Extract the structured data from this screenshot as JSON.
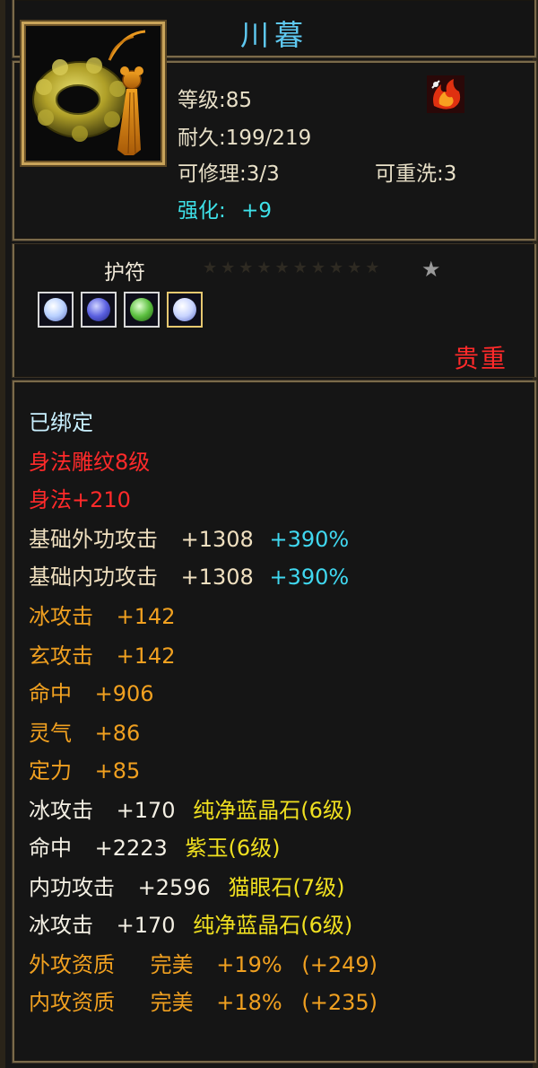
{
  "item": {
    "name": "川暮",
    "level_text": "等级:85",
    "durability_text": "耐久:199/219",
    "repairable_text": "可修理:3/3",
    "rewash_text": "可重洗:3",
    "enhance_label": "强化:",
    "enhance_value": "+9",
    "icon": "jade-ring-pendant-icon",
    "badge_icon": "flame-emblem-icon"
  },
  "amulet": {
    "label": "护符",
    "faded_text": "★★★★★★★★★★",
    "star_icon": "star-icon",
    "gems": [
      {
        "name": "white-gem-icon",
        "color": "#b8d0ff"
      },
      {
        "name": "blue-gem-icon",
        "color": "#5a60e0"
      },
      {
        "name": "green-gem-icon",
        "color": "#5cc040"
      },
      {
        "name": "white-gem-icon",
        "color": "#c8d4ff"
      }
    ],
    "rarity": "贵重"
  },
  "stats": {
    "bound": "已绑定",
    "engraving": "身法雕纹8级",
    "agility": "身法+210",
    "base_ext_attack": {
      "label": "基础外功攻击",
      "value": "+1308",
      "percent": "+390%"
    },
    "base_int_attack": {
      "label": "基础内功攻击",
      "value": "+1308",
      "percent": "+390%"
    },
    "ice_attack": {
      "label": "冰攻击",
      "value": "+142"
    },
    "xuan_attack": {
      "label": "玄攻击",
      "value": "+142"
    },
    "hit": {
      "label": "命中",
      "value": "+906"
    },
    "spirit": {
      "label": "灵气",
      "value": "+86"
    },
    "focus": {
      "label": "定力",
      "value": "+85"
    },
    "gem_line_1": {
      "label": "冰攻击",
      "value": "+170",
      "gem": "纯净蓝晶石(6级)"
    },
    "gem_line_2": {
      "label": "命中",
      "value": "+2223",
      "gem": "紫玉(6级)"
    },
    "gem_line_3": {
      "label": "内功攻击",
      "value": "+2596",
      "gem": "猫眼石(7级)"
    },
    "gem_line_4": {
      "label": "冰攻击",
      "value": "+170",
      "gem": "纯净蓝晶石(6级)"
    },
    "ext_aptitude": {
      "label": "外攻资质",
      "grade": "完美",
      "percent": "+19%",
      "bonus": "(+249)"
    },
    "int_aptitude": {
      "label": "内攻资质",
      "grade": "完美",
      "percent": "+18%",
      "bonus": "(+235)"
    }
  },
  "colors": {
    "title": "#5ec8f0",
    "rarity": "#ff2a2a",
    "frame_gold": "#c9a45a"
  }
}
